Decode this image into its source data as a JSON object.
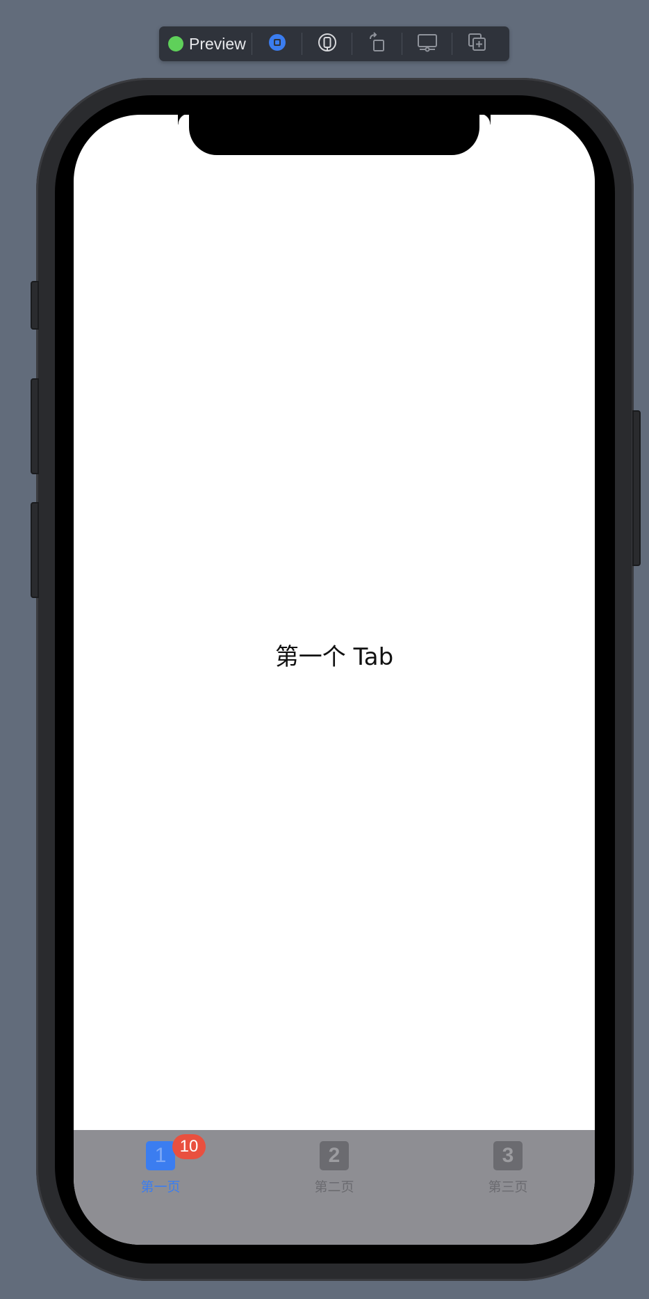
{
  "toolbar": {
    "preview_label": "Preview",
    "status_color": "#5fd05a",
    "buttons": [
      {
        "name": "live-mode-icon"
      },
      {
        "name": "device-select-icon"
      },
      {
        "name": "rotate-icon"
      },
      {
        "name": "device-settings-icon"
      },
      {
        "name": "duplicate-preview-icon"
      }
    ]
  },
  "screen": {
    "content_text": "第一个 Tab"
  },
  "tabbar": {
    "tabs": [
      {
        "icon_text": "1",
        "label": "第一页",
        "badge": "10",
        "selected": true
      },
      {
        "icon_text": "2",
        "label": "第二页",
        "selected": false
      },
      {
        "icon_text": "3",
        "label": "第三页",
        "selected": false
      }
    ],
    "active_color": "#3b7df0",
    "inactive_color": "#6b6b70",
    "background_color": "#8e8e93",
    "badge_color": "#e9503f"
  }
}
